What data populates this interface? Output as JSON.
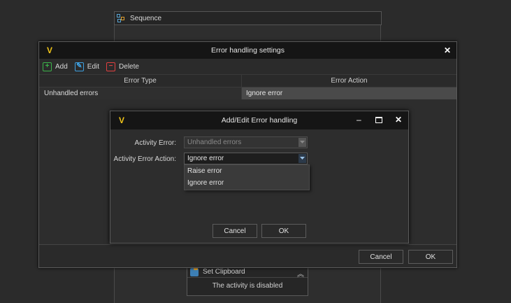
{
  "sequence": {
    "title": "Sequence",
    "icon": "sequence-flowchart-icon"
  },
  "activity": {
    "title": "Set Clipboard",
    "icon": "clipboard-icon",
    "status": "The activity is disabled",
    "collapse_icon": "double-chevron-up-icon"
  },
  "error_dialog": {
    "title": "Error handling settings",
    "logo": "V",
    "close": "✕",
    "toolbar": {
      "add": "Add",
      "edit": "Edit",
      "delete": "Delete"
    },
    "columns": {
      "type": "Error Type",
      "action": "Error Action"
    },
    "rows": [
      {
        "type": "Unhandled errors",
        "action": "Ignore error"
      }
    ],
    "cancel": "Cancel",
    "ok": "OK"
  },
  "edit_dialog": {
    "title": "Add/Edit Error handling",
    "logo": "V",
    "controls": {
      "minimize": "–",
      "close": "✕"
    },
    "activity_error_label": "Activity Error:",
    "activity_error_value": "Unhandled errors",
    "action_label": "Activity Error Action:",
    "action_value": "Ignore error",
    "action_options": [
      "Raise error",
      "Ignore error"
    ],
    "cancel": "Cancel",
    "ok": "OK"
  }
}
